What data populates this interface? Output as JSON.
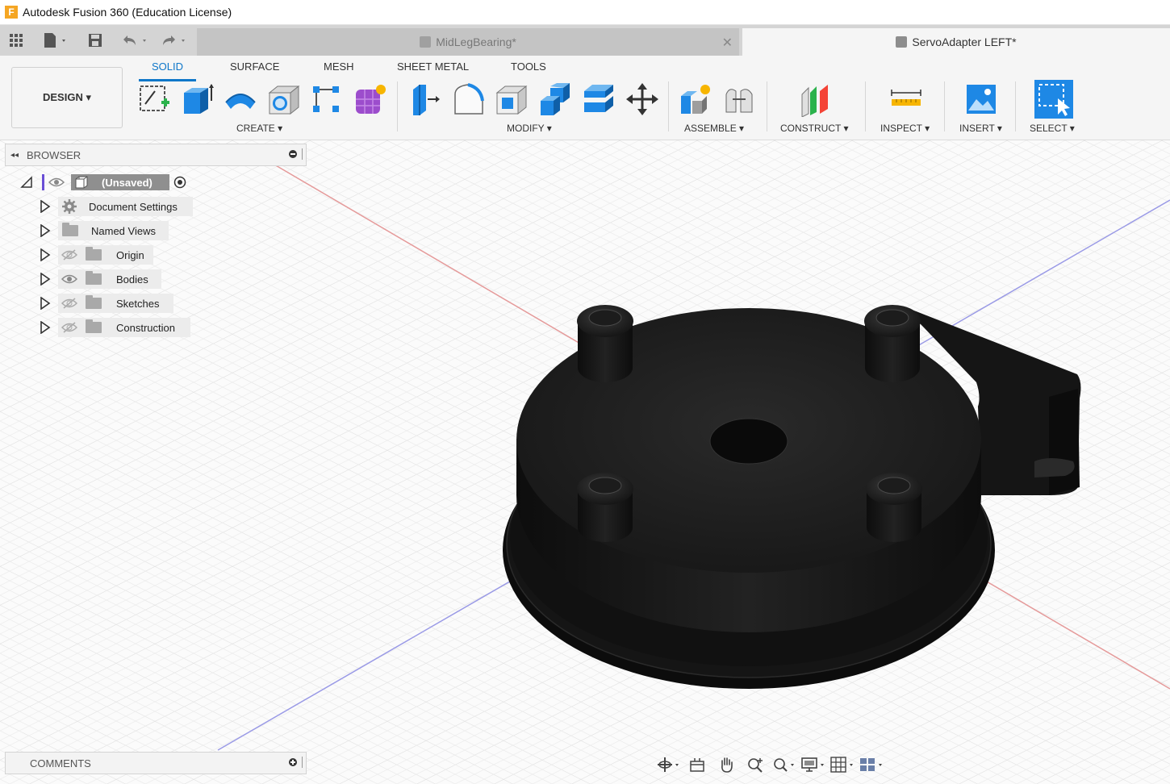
{
  "window": {
    "app_logo": "F",
    "title": "Autodesk Fusion 360 (Education License)"
  },
  "quick_access": {
    "icons": [
      "grid-icon",
      "file-icon",
      "save-icon",
      "undo-icon",
      "redo-icon"
    ]
  },
  "tabs": [
    {
      "label": "MidLegBearing*",
      "active": false,
      "close": "✕"
    },
    {
      "label": "ServoAdapter LEFT*",
      "active": true
    }
  ],
  "workspace": {
    "design_label": "DESIGN ▾",
    "tabs": [
      "SOLID",
      "SURFACE",
      "MESH",
      "SHEET METAL",
      "TOOLS"
    ],
    "active_tab": "SOLID"
  },
  "toolbar_groups": {
    "create": "CREATE ▾",
    "modify": "MODIFY ▾",
    "assemble": "ASSEMBLE ▾",
    "construct": "CONSTRUCT ▾",
    "inspect": "INSPECT ▾",
    "insert": "INSERT ▾",
    "select": "SELECT ▾"
  },
  "browser": {
    "title": "BROWSER",
    "collapse_glyph": "◂◂",
    "root": "(Unsaved)",
    "items": [
      {
        "label": "Document Settings",
        "icon": "gear-icon"
      },
      {
        "label": "Named Views",
        "icon": "folder-icon"
      },
      {
        "label": "Origin",
        "icon": "folder-icon",
        "visible": false
      },
      {
        "label": "Bodies",
        "icon": "folder-icon",
        "visible": true
      },
      {
        "label": "Sketches",
        "icon": "folder-icon",
        "visible": false
      },
      {
        "label": "Construction",
        "icon": "folder-icon",
        "visible": false
      }
    ]
  },
  "comments": {
    "title": "COMMENTS"
  },
  "navbar": {
    "icons": [
      "orbit-icon",
      "look-at-icon",
      "pan-icon",
      "zoom-icon",
      "fit-icon",
      "display-settings-icon",
      "grid-settings-icon",
      "viewports-icon"
    ]
  },
  "colors": {
    "accent": "#0f77c9",
    "model": "#1a1a1a",
    "axis_red": "#e06060",
    "axis_blue": "#6a6ae0"
  }
}
